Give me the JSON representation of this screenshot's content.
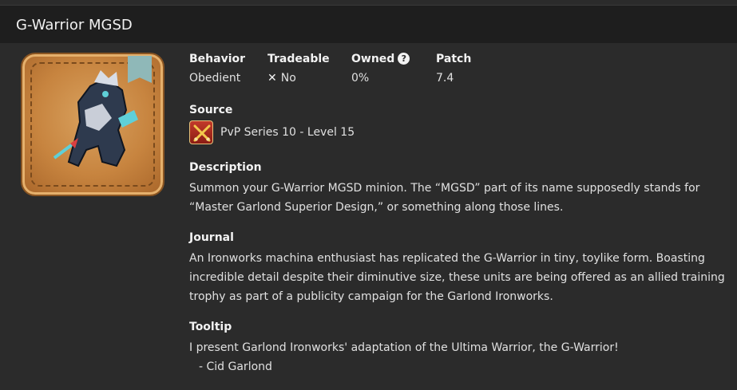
{
  "header": {
    "title": "G-Warrior MGSD"
  },
  "icon": {
    "name": "minion-icon",
    "tag": "tag-icon"
  },
  "stats": {
    "behavior_label": "Behavior",
    "behavior_value": "Obedient",
    "tradeable_label": "Tradeable",
    "tradeable_value": "No",
    "owned_label": "Owned",
    "owned_value": "0%",
    "patch_label": "Patch",
    "patch_value": "7.4"
  },
  "source": {
    "label": "Source",
    "text": "PvP Series 10 - Level 15",
    "icon": "crossed-swords-icon"
  },
  "description": {
    "label": "Description",
    "line1": "Summon your G-Warrior MGSD minion. The “MGSD” part of its name supposedly stands for",
    "line2": "“Master Garlond Superior Design,” or something along those lines."
  },
  "journal": {
    "label": "Journal",
    "line1": "An Ironworks machina enthusiast has replicated the G-Warrior in tiny, toylike form. Boasting",
    "line2": "incredible detail despite their diminutive size, these units are being offered as an allied training",
    "line3": "trophy as part of a publicity campaign for the Garlond Ironworks."
  },
  "tooltip": {
    "label": "Tooltip",
    "line1": "I present Garlond Ironworks' adaptation of the Ultima Warrior, the G-Warrior!",
    "line2": "- Cid Garlond"
  }
}
